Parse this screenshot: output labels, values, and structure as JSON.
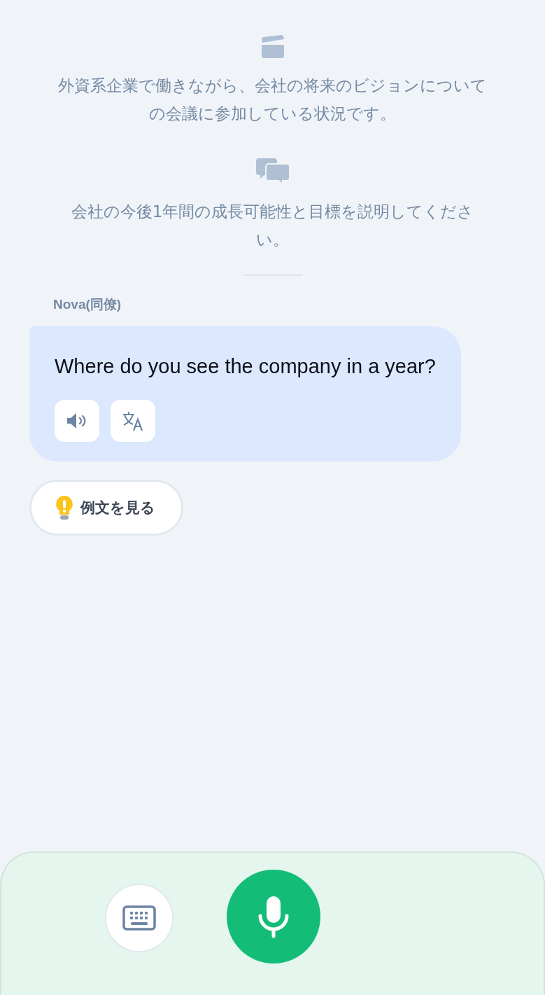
{
  "scenario": {
    "text": "外資系企業で働きながら、会社の将来のビジョンについての会議に参加している状況です。"
  },
  "task": {
    "text": "会社の今後1年間の成長可能性と目標を説明してください。"
  },
  "message": {
    "speaker": "Nova(同僚)",
    "text": "Where do you see the company in a year?"
  },
  "hint_button": {
    "label": "例文を見る"
  }
}
